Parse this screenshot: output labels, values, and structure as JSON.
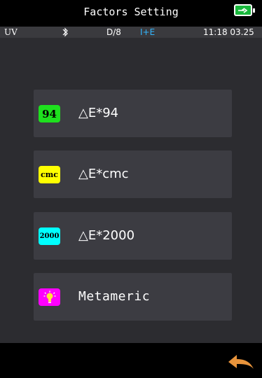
{
  "header": {
    "title": "Factors Setting",
    "battery_icon": "battery-charging-icon"
  },
  "status": {
    "uv": "UV",
    "bluetooth_icon": "bluetooth-icon",
    "geometry": "D/8",
    "mode": "I+E",
    "time": "11:18 03.25"
  },
  "menu": {
    "items": [
      {
        "icon_text": "94",
        "icon_color": "#1ee01e",
        "label": "△E*94"
      },
      {
        "icon_text": "cmc",
        "icon_color": "#ffff00",
        "label": "△E*cmc"
      },
      {
        "icon_text": "2000",
        "icon_color": "#00ffff",
        "label": "△E*2000"
      },
      {
        "icon_text": "",
        "icon_color": "#ff00ff",
        "icon_name": "lightbulb-icon",
        "label": "Metameric"
      }
    ]
  },
  "footer": {
    "back_icon": "back-arrow-icon",
    "back_color": "#e8943c"
  },
  "colors": {
    "background": "#2c2c30",
    "item_background": "#3c3c42",
    "statusbar": "#3a3a3e",
    "accent_blue": "#32b6ff",
    "battery_green": "#19b83c"
  }
}
